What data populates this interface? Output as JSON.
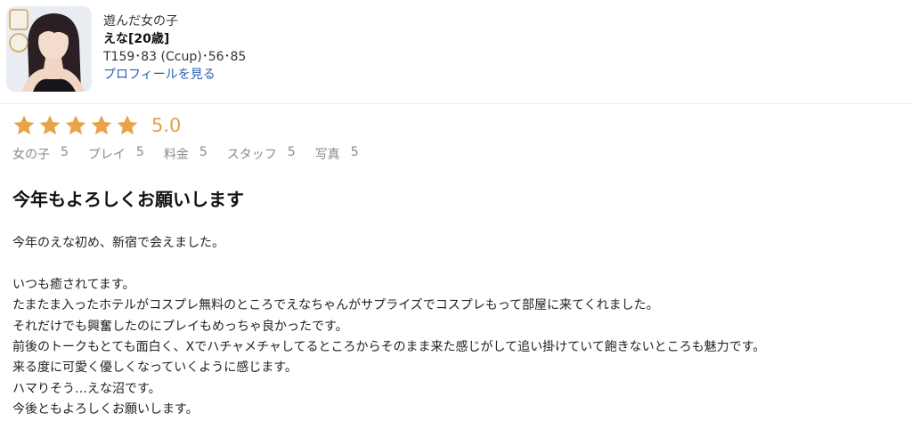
{
  "girl": {
    "label": "遊んだ女の子",
    "name": "えな[20歳]",
    "stats": "T159･83 (Ccup)･56･85",
    "profile_link": "プロフィールを見る"
  },
  "rating": {
    "stars": 5,
    "score": "5.0",
    "star_color": "#e8a24a"
  },
  "sub_ratings": [
    {
      "label": "女の子",
      "value": "5"
    },
    {
      "label": "プレイ",
      "value": "5"
    },
    {
      "label": "料金",
      "value": "5"
    },
    {
      "label": "スタッフ",
      "value": "5"
    },
    {
      "label": "写真",
      "value": "5"
    }
  ],
  "review": {
    "title": "今年もよろしくお願いします",
    "lines": [
      "今年のえな初め、新宿で会えました。",
      "",
      "いつも癒されてます。",
      "たまたま入ったホテルがコスプレ無料のところでえなちゃんがサプライズでコスプレもって部屋に来てくれました。",
      "それだけでも興奮したのにプレイもめっちゃ良かったです。",
      "前後のトークもとても面白く、Xでハチャメチャしてるところからそのまま来た感じがして追い掛けていて飽きないところも魅力です。",
      "来る度に可愛く優しくなっていくように感じます。",
      "ハマりそう…えな沼です。",
      "今後ともよろしくお願いします。"
    ]
  }
}
